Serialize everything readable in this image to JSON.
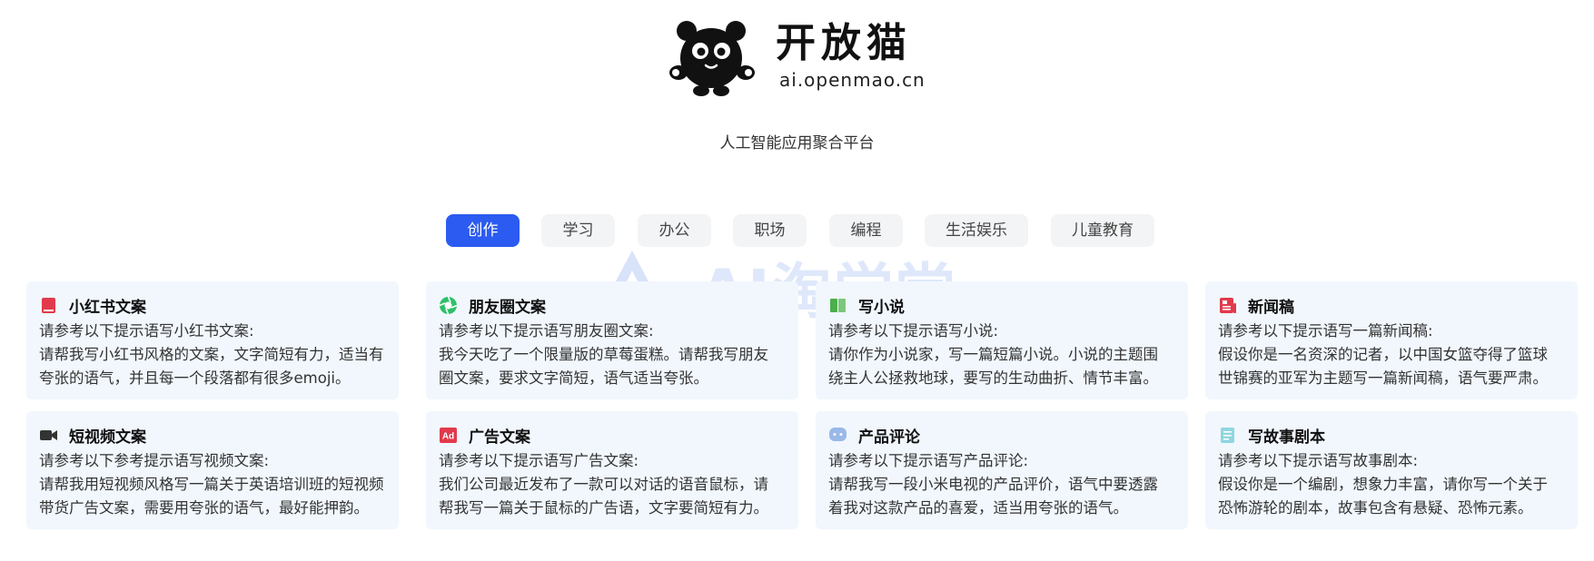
{
  "brand": {
    "name": "开放猫",
    "domain": "ai.openmao.cn",
    "tagline": "人工智能应用聚合平台"
  },
  "watermark": {
    "text": "AI淘学堂"
  },
  "tabs": [
    {
      "label": "创作",
      "active": true
    },
    {
      "label": "学习",
      "active": false
    },
    {
      "label": "办公",
      "active": false
    },
    {
      "label": "职场",
      "active": false
    },
    {
      "label": "编程",
      "active": false
    },
    {
      "label": "生活娱乐",
      "active": false
    },
    {
      "label": "儿童教育",
      "active": false
    }
  ],
  "cards": [
    {
      "title": "小红书文案",
      "icon": "notebook-icon",
      "intro": "请参考以下提示语写小红书文案:",
      "line1": "请帮我写小红书风格的文案，文字简短有力，适当有",
      "line2": "夸张的语气，并且每一个段落都有很多emoji。"
    },
    {
      "title": "朋友圈文案",
      "icon": "moments-icon",
      "intro": "请参考以下提示语写朋友圈文案:",
      "line1": "我今天吃了一个限量版的草莓蛋糕。请帮我写朋友",
      "line2": "圈文案，要求文字简短，语气适当夸张。"
    },
    {
      "title": "写小说",
      "icon": "book-icon",
      "intro": "请参考以下提示语写小说:",
      "line1": "请你作为小说家，写一篇短篇小说。小说的主题围",
      "line2": "绕主人公拯救地球，要写的生动曲折、情节丰富。"
    },
    {
      "title": "新闻稿",
      "icon": "newspaper-icon",
      "intro": "请参考以下提示语写一篇新闻稿:",
      "line1": "假设你是一名资深的记者，以中国女篮夺得了篮球",
      "line2": "世锦赛的亚军为主题写一篇新闻稿，语气要严肃。"
    },
    {
      "title": "短视频文案",
      "icon": "video-camera-icon",
      "intro": "请参考以下参考提示语写视频文案:",
      "line1": "请帮我用短视频风格写一篇关于英语培训班的短视频",
      "line2": "带货广告文案，需要用夸张的语气，最好能押韵。"
    },
    {
      "title": "广告文案",
      "icon": "ad-icon",
      "intro": "请参考以下提示语写广告文案:",
      "line1": "我们公司最近发布了一款可以对话的语音鼠标，请",
      "line2": "帮我写一篇关于鼠标的广告语，文字要简短有力。"
    },
    {
      "title": "产品评论",
      "icon": "chat-bubble-icon",
      "intro": "请参考以下提示语写产品评论:",
      "line1": "请帮我写一段小米电视的产品评价，语气中要透露",
      "line2": "着我对这款产品的喜爱，适当用夸张的语气。"
    },
    {
      "title": "写故事剧本",
      "icon": "script-icon",
      "intro": "请参考以下提示语写故事剧本:",
      "line1": "假设你是一个编剧，想象力丰富，请你写一个关于",
      "line2": "恐怖游轮的剧本，故事包含有悬疑、恐怖元素。"
    }
  ],
  "colors": {
    "accent": "#2b5bf0",
    "card_bg": "#f1f7fd",
    "tab_bg": "#f3f4f6"
  }
}
